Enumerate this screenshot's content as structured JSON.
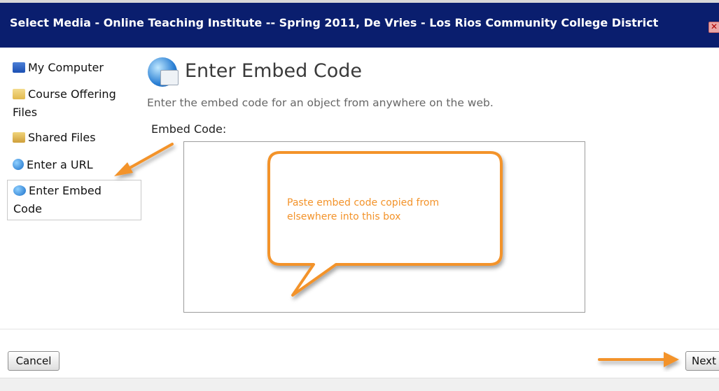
{
  "window": {
    "title": "Select Media - Online Teaching Institute -- Spring 2011, De Vries - Los Rios Community College District"
  },
  "sidebar": {
    "items": [
      {
        "label": "My Computer",
        "icon": "computer-icon"
      },
      {
        "label": "Course Offering Files",
        "icon": "folder-icon"
      },
      {
        "label": "Shared Files",
        "icon": "shared-folder-icon"
      },
      {
        "label": "Enter a URL",
        "icon": "globe-icon"
      },
      {
        "label": "Enter Embed Code",
        "icon": "embed-globe-icon",
        "selected": true
      }
    ]
  },
  "main": {
    "heading": "Enter Embed Code",
    "description": "Enter the embed code for an object from anywhere on the web.",
    "embed_label": "Embed Code:",
    "embed_value": ""
  },
  "annotation": {
    "callout_text": "Paste embed code copied from elsewhere into this box",
    "color": "#f3932a"
  },
  "buttons": {
    "cancel": "Cancel",
    "next": "Next"
  }
}
